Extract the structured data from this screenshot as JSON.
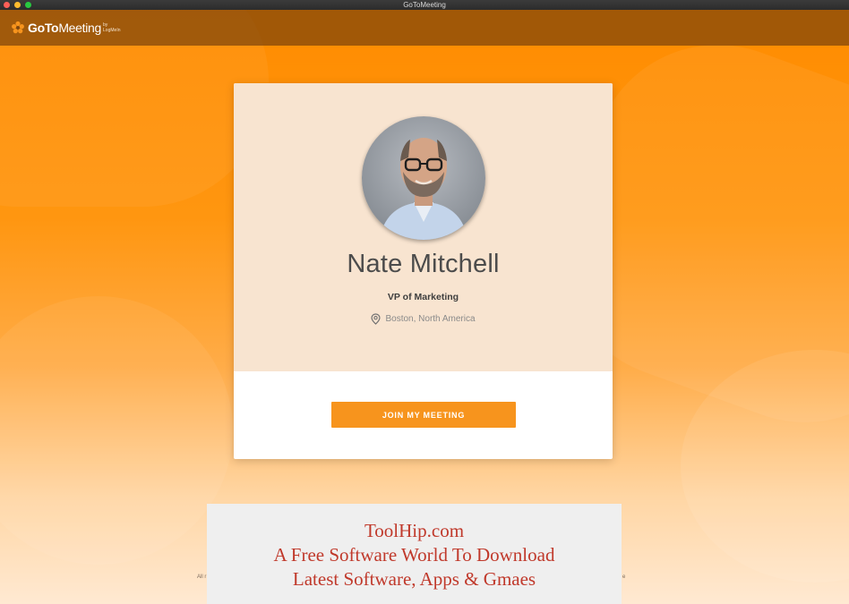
{
  "window": {
    "title": "GoToMeeting"
  },
  "header": {
    "logo_bold": "GoTo",
    "logo_light": "Meeting",
    "logo_tag": "by LogMeIn",
    "brand_color": "#f7941d"
  },
  "card": {
    "name": "Nate Mitchell",
    "role": "VP of Marketing",
    "location": "Boston, North America",
    "location_icon": "map-pin-icon",
    "join_label": "JOIN MY MEETING"
  },
  "footer": {
    "left_fragment": "All r",
    "right_fragment": "e"
  },
  "watermark": {
    "line1": "ToolHip.com",
    "line2": "A Free Software World To Download",
    "line3": "Latest Software, Apps & Gmaes"
  }
}
